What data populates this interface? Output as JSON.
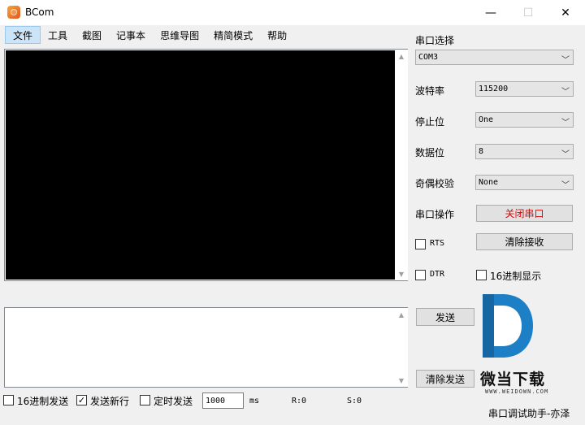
{
  "window": {
    "title": "BCom",
    "minimize": "—",
    "maximize": "☐",
    "close": "✕"
  },
  "menu": [
    "文件",
    "工具",
    "截图",
    "记事本",
    "思维导图",
    "精简模式",
    "帮助"
  ],
  "serial": {
    "port_label": "串口选择",
    "port_value": "COM3",
    "baud_label": "波特率",
    "baud_value": "115200",
    "stop_label": "停止位",
    "stop_value": "One",
    "data_label": "数据位",
    "data_value": "8",
    "parity_label": "奇偶校验",
    "parity_value": "None",
    "op_label": "串口操作",
    "op_button": "关闭串口",
    "rts_label": "RTS",
    "rts_checked": false,
    "clear_recv": "清除接收",
    "dtr_label": "DTR",
    "dtr_checked": false,
    "hex_display": "16进制显示",
    "hex_display_checked": false
  },
  "send": {
    "send_button": "发送",
    "clear_send": "清除发送"
  },
  "bottom": {
    "hex_send": "16进制发送",
    "hex_send_checked": false,
    "newline": "发送新行",
    "newline_checked": true,
    "timed_send": "定时发送",
    "timed_send_checked": false,
    "interval_value": "1000",
    "interval_unit": "ms",
    "rx_count": "R:0",
    "tx_count": "S:0"
  },
  "watermark": {
    "name": "微当下载",
    "url": "WWW.WEIDOWN.COM"
  },
  "status_text": "串口调试助手-亦泽",
  "icons": {
    "check": "✓",
    "chevron": "﹀",
    "up": "▲",
    "down": "▼"
  }
}
